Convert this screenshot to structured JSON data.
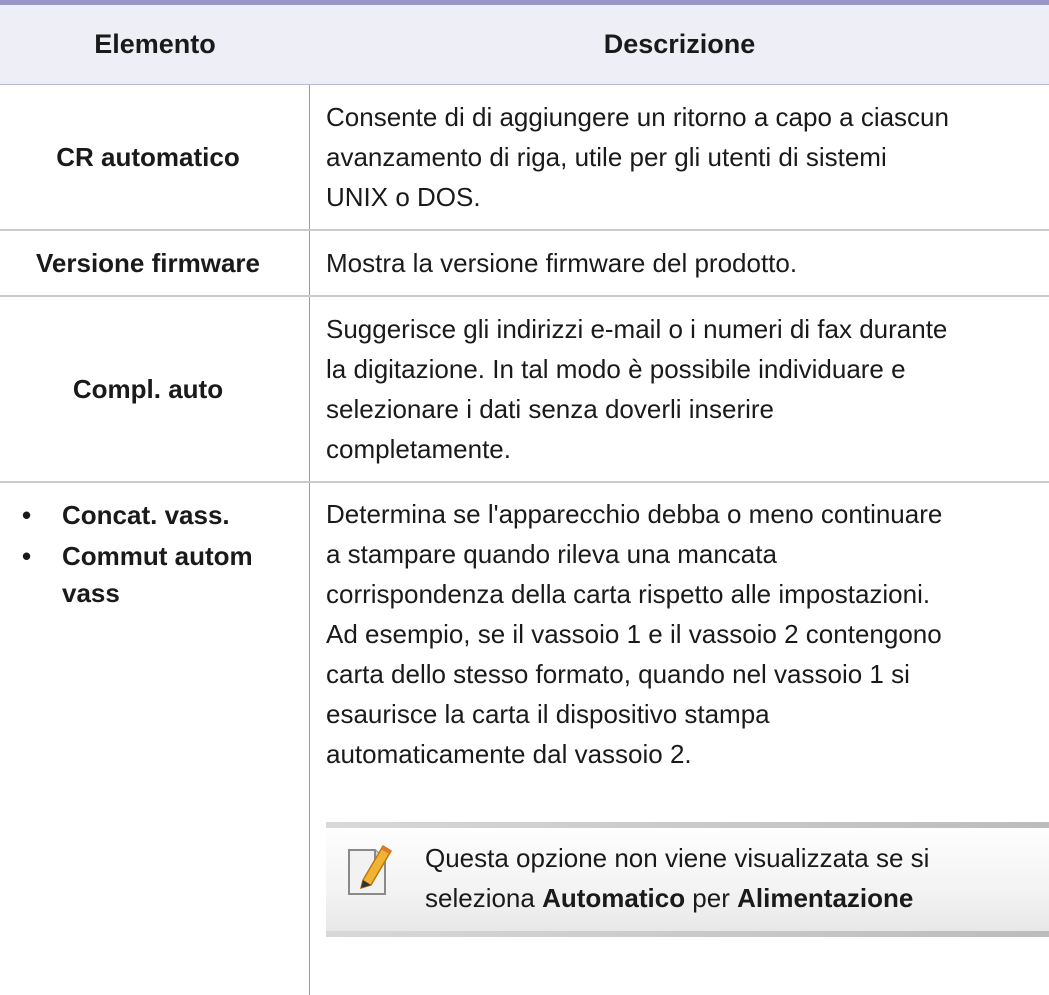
{
  "header": {
    "col1": "Elemento",
    "col2": "Descrizione"
  },
  "rows": [
    {
      "item": "CR automatico",
      "desc": [
        "Consente di di aggiungere un ritorno a capo a ciascun",
        "avanzamento di riga, utile per gli utenti di sistemi",
        "UNIX o DOS."
      ]
    },
    {
      "item": "Versione firmware",
      "desc": [
        "Mostra la versione firmware del prodotto."
      ]
    },
    {
      "item": "Compl. auto",
      "desc": [
        "Suggerisce gli indirizzi e-mail o i numeri di fax durante",
        "la digitazione. In tal modo è possibile individuare e",
        "selezionare i dati senza doverli inserire",
        "completamente."
      ]
    },
    {
      "items": [
        "Concat. vass.",
        "Commut autom vass"
      ],
      "desc": [
        "Determina se l'apparecchio debba o meno continuare",
        "a stampare quando rileva una mancata",
        "corrispondenza della carta rispetto alle impostazioni.",
        "Ad esempio, se il vassoio 1 e il vassoio 2 contengono",
        "carta dello stesso formato, quando nel vassoio 1 si",
        "esaurisce la carta il dispositivo stampa",
        "automaticamente dal vassoio 2."
      ]
    }
  ],
  "note": {
    "line1": "Questa opzione non viene visualizzata se si",
    "line2_prefix": "seleziona ",
    "line2_bold1": "Automatico",
    "line2_mid": " per ",
    "line2_bold2": "Alimentazione"
  }
}
